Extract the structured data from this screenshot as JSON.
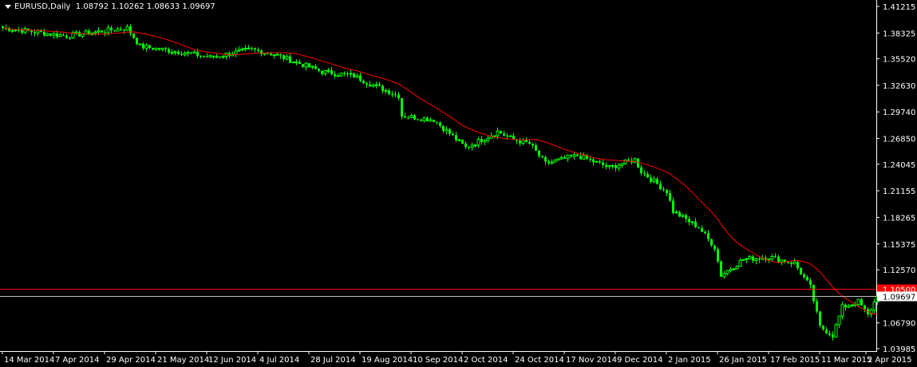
{
  "header": {
    "symbol": "EURUSD,Daily",
    "ohlc": "1.08792 1.10262 1.08633 1.09697"
  },
  "colors": {
    "bull": "#00ff00",
    "bear": "#00ff00",
    "ma": "#ff0000",
    "level": "#ff0000",
    "bid": "#c0c0c0",
    "axis": "#ffffff"
  },
  "chart_data": {
    "type": "candlestick",
    "title": "EURUSD,Daily",
    "ylim": [
      1.03985,
      1.41215
    ],
    "y_ticks": [
      "1.41215",
      "1.38325",
      "1.35520",
      "1.32630",
      "1.29740",
      "1.26850",
      "1.24045",
      "1.21155",
      "1.18265",
      "1.15375",
      "1.12570",
      "1.06790",
      "1.03985"
    ],
    "x_ticks": [
      "14 Mar 2014",
      "7 Apr 2014",
      "29 Apr 2014",
      "21 May 2014",
      "12 Jun 2014",
      "4 Jul 2014",
      "28 Jul 2014",
      "19 Aug 2014",
      "10 Sep 2014",
      "2 Oct 2014",
      "24 Oct 2014",
      "17 Nov 2014",
      "9 Dec 2014",
      "2 Jan 2015",
      "26 Jan 2015",
      "17 Feb 2015",
      "11 Mar 2015",
      "2 Apr 2015"
    ],
    "bars": 275,
    "close_path": [
      [
        0,
        1.3887
      ],
      [
        20,
        1.38
      ],
      [
        39,
        1.3887
      ],
      [
        43,
        1.3687
      ],
      [
        60,
        1.3601
      ],
      [
        65,
        1.3566
      ],
      [
        78,
        1.3653
      ],
      [
        85,
        1.3601
      ],
      [
        100,
        1.341
      ],
      [
        110,
        1.3366
      ],
      [
        115,
        1.328
      ],
      [
        124,
        1.3149
      ],
      [
        125,
        1.2932
      ],
      [
        135,
        1.2889
      ],
      [
        145,
        1.2585
      ],
      [
        155,
        1.2759
      ],
      [
        160,
        1.2672
      ],
      [
        165,
        1.2628
      ],
      [
        170,
        1.2411
      ],
      [
        180,
        1.2498
      ],
      [
        190,
        1.2368
      ],
      [
        198,
        1.2455
      ],
      [
        200,
        1.2325
      ],
      [
        208,
        1.2108
      ],
      [
        210,
        1.1891
      ],
      [
        218,
        1.1717
      ],
      [
        223,
        1.15
      ],
      [
        225,
        1.1196
      ],
      [
        232,
        1.137
      ],
      [
        240,
        1.1396
      ],
      [
        248,
        1.1327
      ],
      [
        253,
        1.1066
      ],
      [
        256,
        1.0632
      ],
      [
        260,
        1.0545
      ],
      [
        263,
        1.0849
      ],
      [
        268,
        1.091
      ],
      [
        271,
        1.0762
      ],
      [
        274,
        1.09697
      ]
    ],
    "ma_period": 20,
    "levels": [
      {
        "label": "1.10500",
        "price": 1.105,
        "type": "alert"
      },
      {
        "label": "1.09697",
        "price": 1.09697,
        "type": "bid"
      }
    ]
  }
}
